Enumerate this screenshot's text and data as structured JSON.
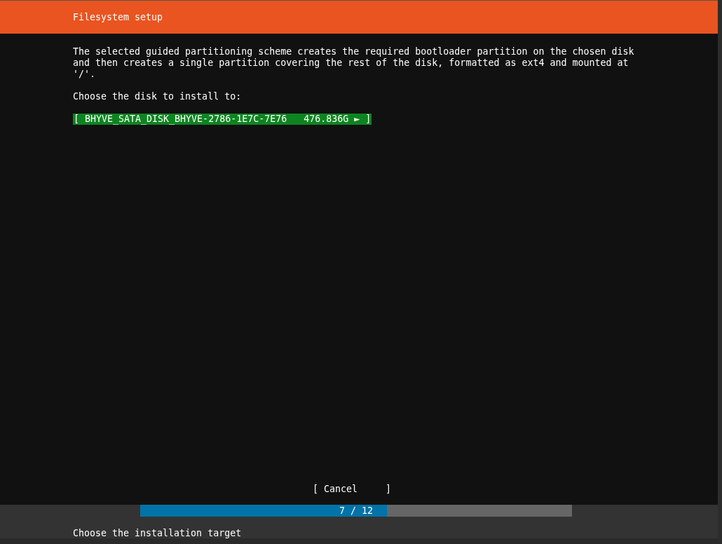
{
  "header": {
    "title": "Filesystem setup"
  },
  "description": "The selected guided partitioning scheme creates the required bootloader partition on the chosen disk and then creates a single partition covering the rest of the disk, formatted as ext4 and mounted at '/'.",
  "prompt": "Choose the disk to install to:",
  "disks": [
    {
      "label": "[ BHYVE_SATA_DISK_BHYVE-2786-1E7C-7E76   476.836G ► ]",
      "selected": true
    }
  ],
  "cancel_button": "[ Cancel     ]",
  "progress": {
    "level": 0.5714,
    "text": "7 / 12"
  },
  "status_bar": "Choose the installation target"
}
